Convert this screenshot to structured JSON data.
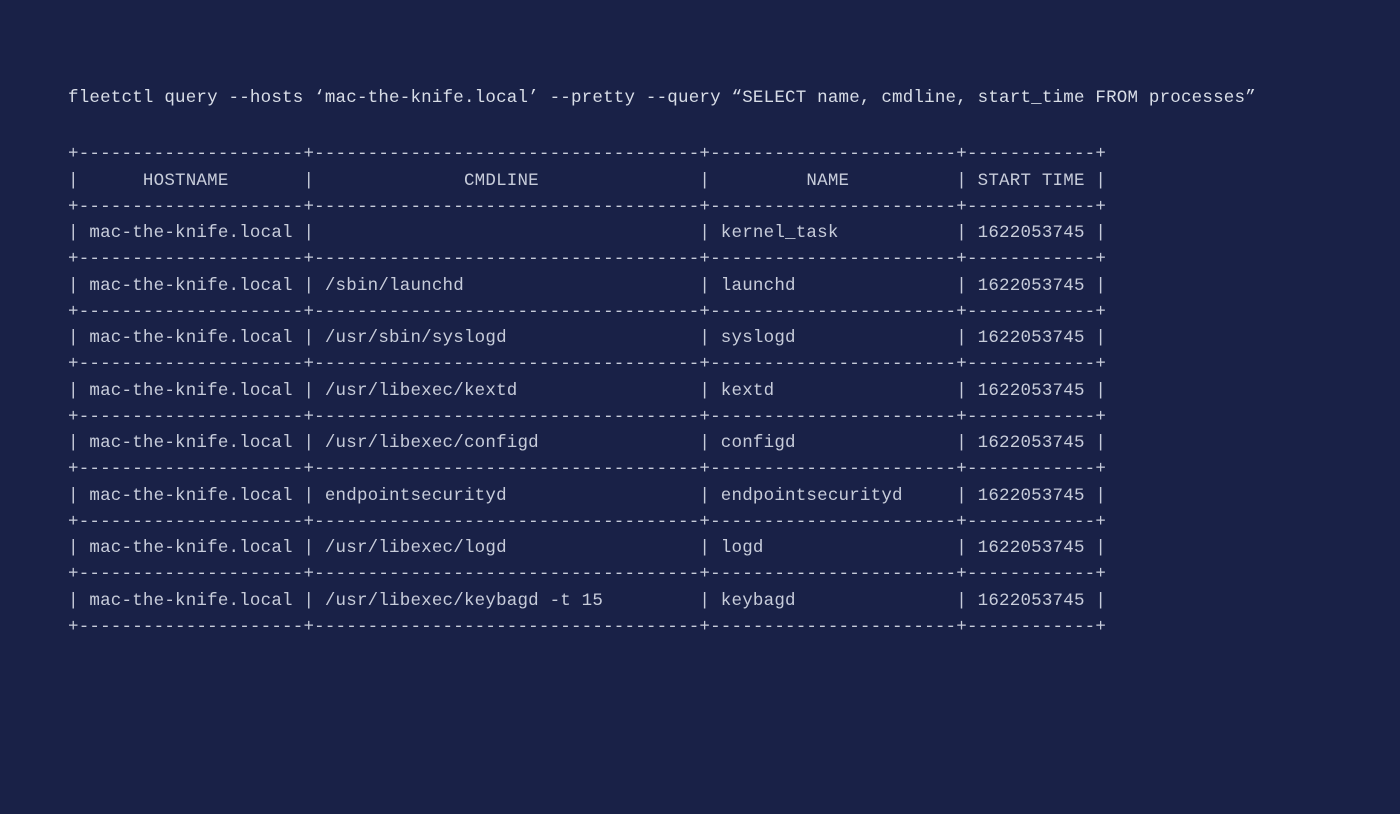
{
  "command": "fleetctl query --hosts ‘mac-the-knife.local’ --pretty --query “SELECT name, cmdline, start_time FROM processes”",
  "columns": {
    "widths": [
      21,
      36,
      23,
      12
    ],
    "headers": [
      "HOSTNAME",
      "CMDLINE",
      "NAME",
      "START TIME"
    ]
  },
  "rows": [
    {
      "hostname": "mac-the-knife.local",
      "cmdline": "",
      "name": "kernel_task",
      "start_time": "1622053745"
    },
    {
      "hostname": "mac-the-knife.local",
      "cmdline": "/sbin/launchd",
      "name": "launchd",
      "start_time": "1622053745"
    },
    {
      "hostname": "mac-the-knife.local",
      "cmdline": "/usr/sbin/syslogd",
      "name": "syslogd",
      "start_time": "1622053745"
    },
    {
      "hostname": "mac-the-knife.local",
      "cmdline": "/usr/libexec/kextd",
      "name": "kextd",
      "start_time": "1622053745"
    },
    {
      "hostname": "mac-the-knife.local",
      "cmdline": "/usr/libexec/configd",
      "name": "configd",
      "start_time": "1622053745"
    },
    {
      "hostname": "mac-the-knife.local",
      "cmdline": "endpointsecurityd",
      "name": "endpointsecurityd",
      "start_time": "1622053745"
    },
    {
      "hostname": "mac-the-knife.local",
      "cmdline": "/usr/libexec/logd",
      "name": "logd",
      "start_time": "1622053745"
    },
    {
      "hostname": "mac-the-knife.local",
      "cmdline": "/usr/libexec/keybagd -t 15",
      "name": "keybagd",
      "start_time": "1622053745"
    }
  ]
}
